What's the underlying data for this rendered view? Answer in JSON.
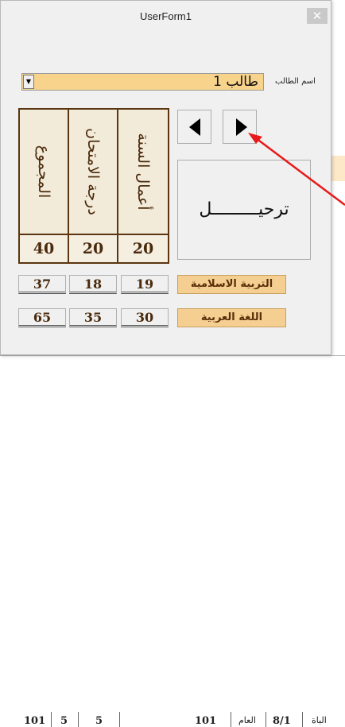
{
  "window": {
    "title": "UserForm1",
    "close_symbol": "✕"
  },
  "student": {
    "label": "اسم الطالب",
    "value": "طالب 1",
    "dropdown_symbol": "▼"
  },
  "grade_headers": [
    {
      "label": "المجموع",
      "max": "40"
    },
    {
      "label": "درجة الامتحان",
      "max": "20"
    },
    {
      "label": "أعمال السنة",
      "max": "20"
    }
  ],
  "navigation": {
    "prev_icon": "left-triangle",
    "next_icon": "right-triangle"
  },
  "transfer_button": {
    "label": "ترحيـــــــــل"
  },
  "subjects": [
    {
      "name": "التربية الاسلامية",
      "total": "37",
      "exam": "18",
      "year_work": "19"
    },
    {
      "name": "اللغة العربية",
      "total": "65",
      "exam": "35",
      "year_work": "30"
    }
  ],
  "background_sheet": {
    "bottom_cells": [
      "101",
      "5",
      "5",
      "101",
      "العام",
      "8/1",
      "الباة"
    ]
  },
  "colors": {
    "accent_tan": "#f7d38c",
    "label_tan": "#f5cf92",
    "header_brown": "#5a3510",
    "arrow_red": "#e8191a"
  }
}
